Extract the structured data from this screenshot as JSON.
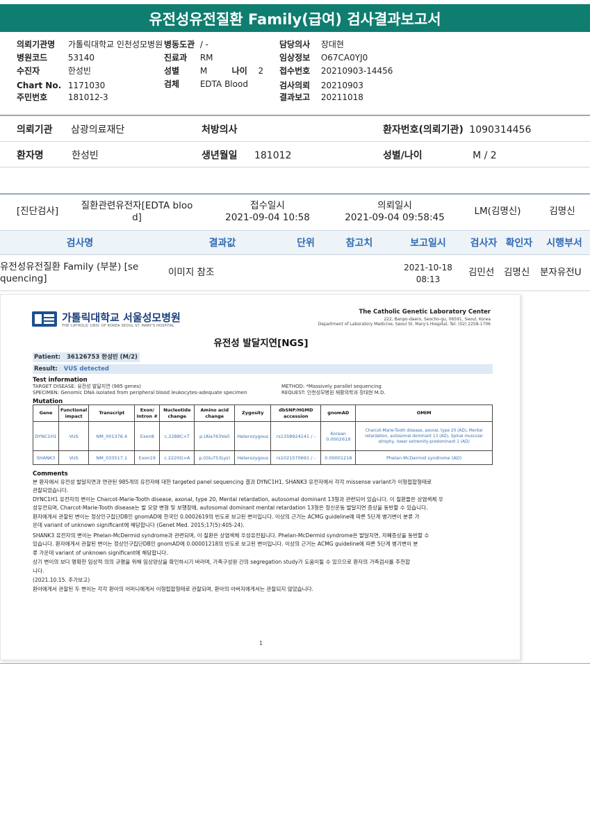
{
  "title": "유전성유전질환 Family(급여) 검사결과보고서",
  "header": {
    "left": [
      {
        "label": "의뢰기관명",
        "value": "가톨릭대학교 인천성모병원"
      },
      {
        "label": "병원코드",
        "value": "53140"
      },
      {
        "label": "수진자",
        "value": "한성빈"
      },
      {
        "label": "Chart No.",
        "value": "1171030"
      },
      {
        "label": "주민번호",
        "value": "181012-3"
      }
    ],
    "mid": [
      {
        "label": "병동도관",
        "value": "/ -"
      },
      {
        "label": "진료과",
        "value": "RM"
      },
      {
        "label": "성별",
        "value": "M"
      },
      {
        "label": "검체",
        "value": "EDTA Blood"
      }
    ],
    "age_label": "나이",
    "age_value": "2",
    "right": [
      {
        "label": "담당의사",
        "value": "장대현"
      },
      {
        "label": "임상정보",
        "value": "O67CA0YJ0"
      },
      {
        "label": "접수번호",
        "value": "20210903-14456"
      },
      {
        "label": "검사의뢰",
        "value": "20210903"
      },
      {
        "label": "결과보고",
        "value": "20211018"
      }
    ]
  },
  "patient": {
    "org_label": "의뢰기관",
    "org_value": "삼광의료재단",
    "doctor_label": "처방의사",
    "doctor_value": "",
    "pid_label": "환자번호(의뢰기관)",
    "pid_value": "1090314456",
    "name_label": "환자명",
    "name_value": "한성빈",
    "dob_label": "생년월일",
    "dob_value": "181012",
    "sexage_label": "성별/나이",
    "sexage_value": "M / 2"
  },
  "order": {
    "category": "[진단검사]",
    "test_line1": "질환관련유전자[EDTA bloo",
    "test_line2": "d]",
    "recv_label": "접수일시",
    "recv_value": "2021-09-04  10:58",
    "req_label": "의뢰일시",
    "req_value": "2021-09-04  09:58:45",
    "lm": "LM(김명신)",
    "lm_name": "김명신"
  },
  "columns": [
    "검사명",
    "결과값",
    "단위",
    "참고치",
    "보고일시",
    "검사자",
    "확인자",
    "시행부서"
  ],
  "result": {
    "name_line1": "유전성유전질환 Family (부분) [se",
    "name_line2": "quencing]",
    "value": "이미지 참조",
    "date": "2021-10-18",
    "time": "08:13",
    "tester": "김민선",
    "confirmer": "김명신",
    "dept": "분자유전U"
  },
  "report": {
    "hospital": "가톨릭대학교 서울성모병원",
    "hospital_en": "THE CATHOLIC UNIV. OF KOREA SEOUL ST. MARY'S HOSPITAL",
    "lab_name": "The Catholic Genetic Laboratory Center",
    "lab_addr": "222, Banpo-daero, Seocho-gu, 06591, Seoul, Korea",
    "lab_dept": "Department of Laboratory Medicine, Seoul St. Mary's Hospital, Tel: (02) 2258-1706",
    "doc_title": "유전성 발달지연[NGS]",
    "patient_label": "Patient:",
    "patient_value": "36126753 한성빈 (M/2)",
    "result_label": "Result:",
    "result_value": "VUS detected",
    "test_info_title": "Test information",
    "target": "TARGET DISEASE: 유전성 발달지연 (985 genes)",
    "specimen": "SPECIMEN: Genomic DNA isolated from peripheral blood leukocytes-adequate specimen",
    "method": "METHOD: *Massively parallel sequencing",
    "request": "REQUEST: 인천성모병원 재활의학과 장대현 M.D.",
    "mutation_title": "Mutation",
    "table_headers": [
      "Gene",
      "Functional impact",
      "Transcript",
      "Exon/ Intron #",
      "Nucleotide change",
      "Amino acid change",
      "Zygosity",
      "dbSNP/HGMD accession",
      "gnomAD",
      "OMIM"
    ],
    "rows": [
      [
        "DYNC1H1",
        "VUS",
        "NM_001376.4",
        "Exon8",
        "c.2288C>T",
        "p.(Ala763Val)",
        "Heterozygous",
        "rs1358924141 / -",
        "Korean 0.0002619",
        "Charcot-Marie-Tooth disease, axonal, type 20 (AD), Mental retardation, autosomal dominant 13 (AD), Spinal muscular atrophy, lower extremity-predominant 1 (AD)"
      ],
      [
        "SHANK3",
        "VUS",
        "NM_033517.1",
        "Exon19",
        "c.2220G>A",
        "p.(Glu753Lys)",
        "Heterozygous",
        "rs1021570691 / -",
        "0.00001218",
        "Phelan-McDermid syndrome (AD)"
      ]
    ],
    "comments_title": "Comments",
    "comments": [
      "본 환자에서 유전성 발달지연과 연관된 985개의 유전자에 대한 targeted panel sequencing 결과 DYNC1H1, SHANK3 유전자에서 각각 missense variant가 이형접합형태로",
      "관찰되었습니다.",
      "DYNC1H1 유전자의 변이는 Charcot-Marie-Tooth disease, axonal, type 20, Mental retardation, autosomal dominant 13형과 관련되어 있습니다. 이 질환들은 상염색체 우",
      "성유전되며, Charcot-Marie-Tooth disease는 발 모양 변형 및 보행장애, autosomal dominant mental retardation 13형은 정신운동 발달지연 증상을 동반할 수 있습니다.",
      "환자에게서 관찰된 변이는 정상인구집단DB인 gnomAD에 한국인 0.0002619의 빈도로 보고된 변이입니다. 이상의 근거는 ACMG guideline에 따른 5단계 병기변이 분류 가",
      "운데 variant of unknown significant에 해당합니다 (Genet Med. 2015;17(5):405-24).",
      "SHANK3 유전자의 변이는 Phelan-McDermid syndrome과 관련되며, 이 질환은 상염색체 우성유전됩니다. Phelan-McDermid syndrome은 발달지연, 자폐증상을 동반할 수",
      "있습니다. 환자에게서 관찰된 변이는 정상인구집단DB인 gnomAD에 0.00001218의 빈도로 보고된 변이입니다. 이상의 근거는 ACMG guideline에 따른 5단계 병기변이 분",
      "류 가운데 variant of unknown significant에 해당합니다.",
      "상기 변이의 보다 명확한 임상적 의의 규명을 위해 임상양상을 확인하시기 바라며, 가족구성원 간의 segregation study가 도움이될 수 있으므로 환자의 가족검사를 추천합",
      "니다.",
      "(2021.10.15. 추가보고)",
      "환아에게서 관찰된 두 변이는 각각 환아의 어머니에게서 이형접합형태로 관찰되며, 환아의 아버지에게서는 관찰되지 않았습니다."
    ],
    "page": "1"
  },
  "colors": {
    "title_bg": "#0f7d70",
    "header_blue": "#2e6cb5",
    "vus_blue": "#3a6fb0"
  }
}
